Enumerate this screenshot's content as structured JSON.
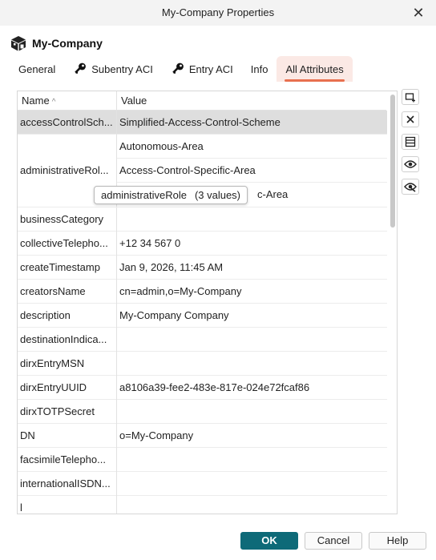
{
  "window": {
    "title": "My-Company Properties",
    "close_glyph": "✕"
  },
  "object": {
    "name": "My-Company",
    "icon": "cube-icon"
  },
  "tabs": [
    {
      "label": "General",
      "icon": null,
      "active": false
    },
    {
      "label": "Subentry ACI",
      "icon": "key-icon",
      "active": false
    },
    {
      "label": "Entry ACI",
      "icon": "key-icon",
      "active": false
    },
    {
      "label": "Info",
      "icon": null,
      "active": false
    },
    {
      "label": "All Attributes",
      "icon": null,
      "active": true
    }
  ],
  "table": {
    "columns": {
      "name": "Name",
      "value": "Value",
      "sort": "ascending"
    },
    "rows": [
      {
        "name": "accessControlSch...",
        "values": [
          "Simplified-Access-Control-Scheme"
        ],
        "selected": true
      },
      {
        "name": "administrativeRol...",
        "values": [
          "Autonomous-Area",
          "Access-Control-Specific-Area",
          "c-Area"
        ]
      },
      {
        "name": "businessCategory",
        "values": [
          ""
        ]
      },
      {
        "name": "collectiveTelepho...",
        "values": [
          "+12 34 567 0"
        ]
      },
      {
        "name": "createTimestamp",
        "values": [
          "Jan 9, 2026, 11:45 AM"
        ]
      },
      {
        "name": "creatorsName",
        "values": [
          "cn=admin,o=My-Company"
        ]
      },
      {
        "name": "description",
        "values": [
          "My-Company Company"
        ]
      },
      {
        "name": "destinationIndica...",
        "values": [
          ""
        ]
      },
      {
        "name": "dirxEntryMSN",
        "values": [
          ""
        ]
      },
      {
        "name": "dirxEntryUUID",
        "values": [
          "a8106a39-fee2-483e-817e-024e72fcaf86"
        ]
      },
      {
        "name": "dirxTOTPSecret",
        "values": [
          ""
        ]
      },
      {
        "name": "DN",
        "values": [
          "o=My-Company"
        ]
      },
      {
        "name": "facsimileTelepho...",
        "values": [
          ""
        ]
      },
      {
        "name": "internationalISDN...",
        "values": [
          ""
        ]
      },
      {
        "name": "l",
        "values": [
          ""
        ]
      }
    ]
  },
  "tooltip": {
    "attribute": "administrativeRole",
    "count": "(3 values)"
  },
  "side_tools": [
    {
      "name": "add-value-icon"
    },
    {
      "name": "delete-icon"
    },
    {
      "name": "edit-list-icon"
    },
    {
      "name": "show-icon"
    },
    {
      "name": "hide-icon"
    }
  ],
  "buttons": {
    "ok": "OK",
    "cancel": "Cancel",
    "help": "Help"
  },
  "colors": {
    "accent": "#e8704f",
    "primary_button": "#0e6a78",
    "selected_row": "#dedede",
    "active_tab_bg": "#fbe9e5"
  }
}
